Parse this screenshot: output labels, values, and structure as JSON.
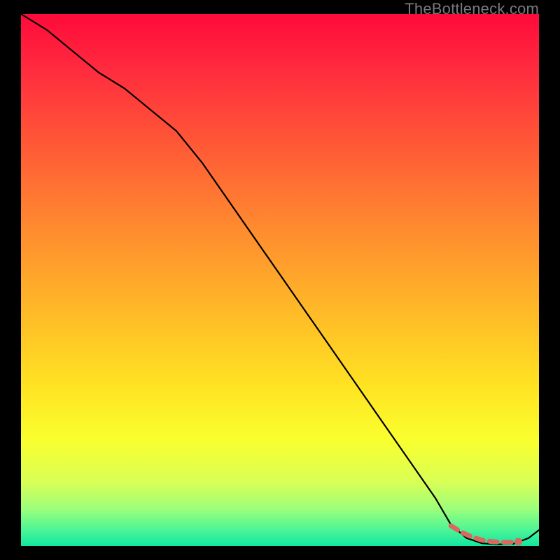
{
  "watermark": "TheBottleneck.com",
  "chart_data": {
    "type": "line",
    "title": "",
    "xlabel": "",
    "ylabel": "",
    "xlim": [
      0,
      100
    ],
    "ylim": [
      0,
      100
    ],
    "grid": false,
    "series": [
      {
        "name": "curve",
        "color": "#000000",
        "x": [
          0,
          5,
          10,
          15,
          20,
          25,
          30,
          35,
          40,
          45,
          50,
          55,
          60,
          65,
          70,
          75,
          80,
          83,
          86,
          89,
          92,
          95,
          98,
          100
        ],
        "y": [
          100,
          97,
          93,
          89,
          86,
          82,
          78,
          72,
          65,
          58,
          51,
          44,
          37,
          30,
          23,
          16,
          9,
          4,
          1.5,
          0.5,
          0.3,
          0.4,
          1.5,
          3
        ]
      },
      {
        "name": "dashed-segment",
        "color": "#d9685e",
        "style": "dashed",
        "x": [
          83,
          85,
          87,
          89,
          91,
          93,
          95
        ],
        "y": [
          3.8,
          2.6,
          1.7,
          1.1,
          0.8,
          0.7,
          0.7
        ]
      },
      {
        "name": "marker",
        "type": "scatter",
        "color": "#d9685e",
        "x": [
          96
        ],
        "y": [
          0.8
        ]
      }
    ],
    "gradient_stops": [
      {
        "pos": 0,
        "color": "#ff0a3a"
      },
      {
        "pos": 10,
        "color": "#ff2a3e"
      },
      {
        "pos": 25,
        "color": "#ff5a36"
      },
      {
        "pos": 40,
        "color": "#ff8a2f"
      },
      {
        "pos": 55,
        "color": "#ffb728"
      },
      {
        "pos": 70,
        "color": "#ffe322"
      },
      {
        "pos": 80,
        "color": "#faff2e"
      },
      {
        "pos": 88,
        "color": "#d8ff55"
      },
      {
        "pos": 93,
        "color": "#9dff7a"
      },
      {
        "pos": 97,
        "color": "#4cf596"
      },
      {
        "pos": 100,
        "color": "#11e7a0"
      }
    ]
  }
}
